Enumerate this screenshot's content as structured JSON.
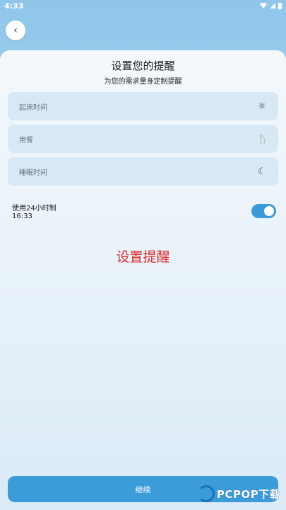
{
  "status_bar": {
    "time": "4:33"
  },
  "header": {
    "back_icon": "chevron-left-icon",
    "back_glyph": "‹"
  },
  "page": {
    "title": "设置您的提醒",
    "subtitle": "为您的需求量身定制提醒"
  },
  "fields": [
    {
      "label": "起床时间",
      "icon": "sun-icon",
      "glyph": "☼"
    },
    {
      "label": "用餐",
      "icon": "cutlery-icon",
      "glyph": "🍴"
    },
    {
      "label": "睡眠时间",
      "icon": "sleep-icon",
      "glyph": "☾"
    }
  ],
  "clock_toggle": {
    "label": "使用24小时制",
    "time": "16:33",
    "enabled": true
  },
  "overlay_text": "设置提醒",
  "continue_button": {
    "label": "继续"
  },
  "watermark_logo": {
    "text": "PCPOP下载"
  },
  "colors": {
    "accent": "#3c9cd9",
    "overlay_text": "#d62e2e"
  }
}
